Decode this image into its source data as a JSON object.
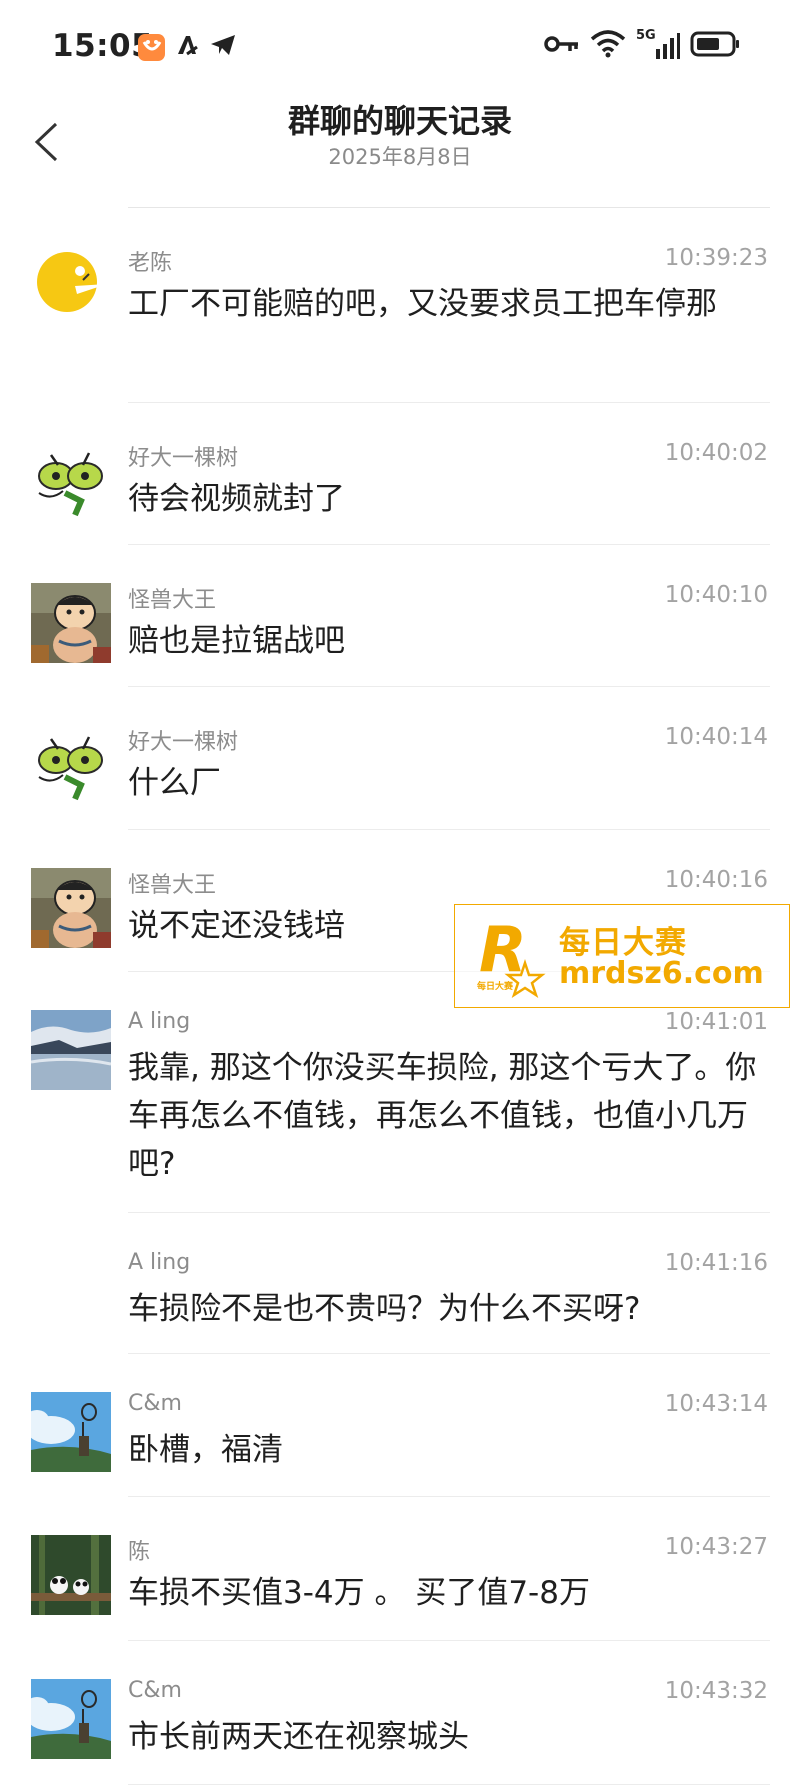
{
  "status_bar": {
    "time": "15:05",
    "icons": [
      "app-notification-icon",
      "font-icon",
      "telegram-icon",
      "key-icon",
      "wifi-icon",
      "5g-signal-icon",
      "battery-icon"
    ],
    "network_label": "5G"
  },
  "header": {
    "title": "群聊的聊天记录",
    "date": "2025年8月8日"
  },
  "messages": [
    {
      "sender": "老陈",
      "time": "10:39:23",
      "text": "工厂不可能赔的吧，又没要求员工把车停那",
      "avatar": "yellow-moon-avatar"
    },
    {
      "sender": "好大一棵树",
      "time": "10:40:02",
      "text": "待会视频就封了",
      "avatar": "green-cartoon-avatar"
    },
    {
      "sender": "怪兽大王",
      "time": "10:40:10",
      "text": "赔也是拉锯战吧",
      "avatar": "crayon-shin-chan-avatar"
    },
    {
      "sender": "好大一棵树",
      "time": "10:40:14",
      "text": "什么厂",
      "avatar": "green-cartoon-avatar"
    },
    {
      "sender": "怪兽大王",
      "time": "10:40:16",
      "text": "说不定还没钱培",
      "avatar": "crayon-shin-chan-avatar"
    },
    {
      "sender": "A ling",
      "time": "10:41:01",
      "text": "我靠, 那这个你没买车损险, 那这个亏大了。你车再怎么不值钱，再怎么不值钱，也值小几万吧?",
      "avatar": "lake-landscape-avatar"
    },
    {
      "sender": "A ling",
      "time": "10:41:16",
      "text": "车损险不是也不贵吗？为什么不买呀?",
      "avatar": ""
    },
    {
      "sender": "C&m",
      "time": "10:43:14",
      "text": "卧槽，福清",
      "avatar": "sky-anime-avatar"
    },
    {
      "sender": "陈",
      "time": "10:43:27",
      "text": "车损不买值3-4万 。 买了值7-8万",
      "avatar": "panda-forest-avatar"
    },
    {
      "sender": "C&m",
      "time": "10:43:32",
      "text": "市长前两天还在视察城头",
      "avatar": "sky-anime-avatar"
    }
  ],
  "watermark": {
    "brand": "每日大赛",
    "url": "mrdsz6.com",
    "logo_letter": "R",
    "logo_sub": "每日大赛"
  },
  "colors": {
    "text": "#1f1f1f",
    "meta": "#8c8c8c",
    "divider": "#ececec",
    "watermark": "#f2a900"
  }
}
